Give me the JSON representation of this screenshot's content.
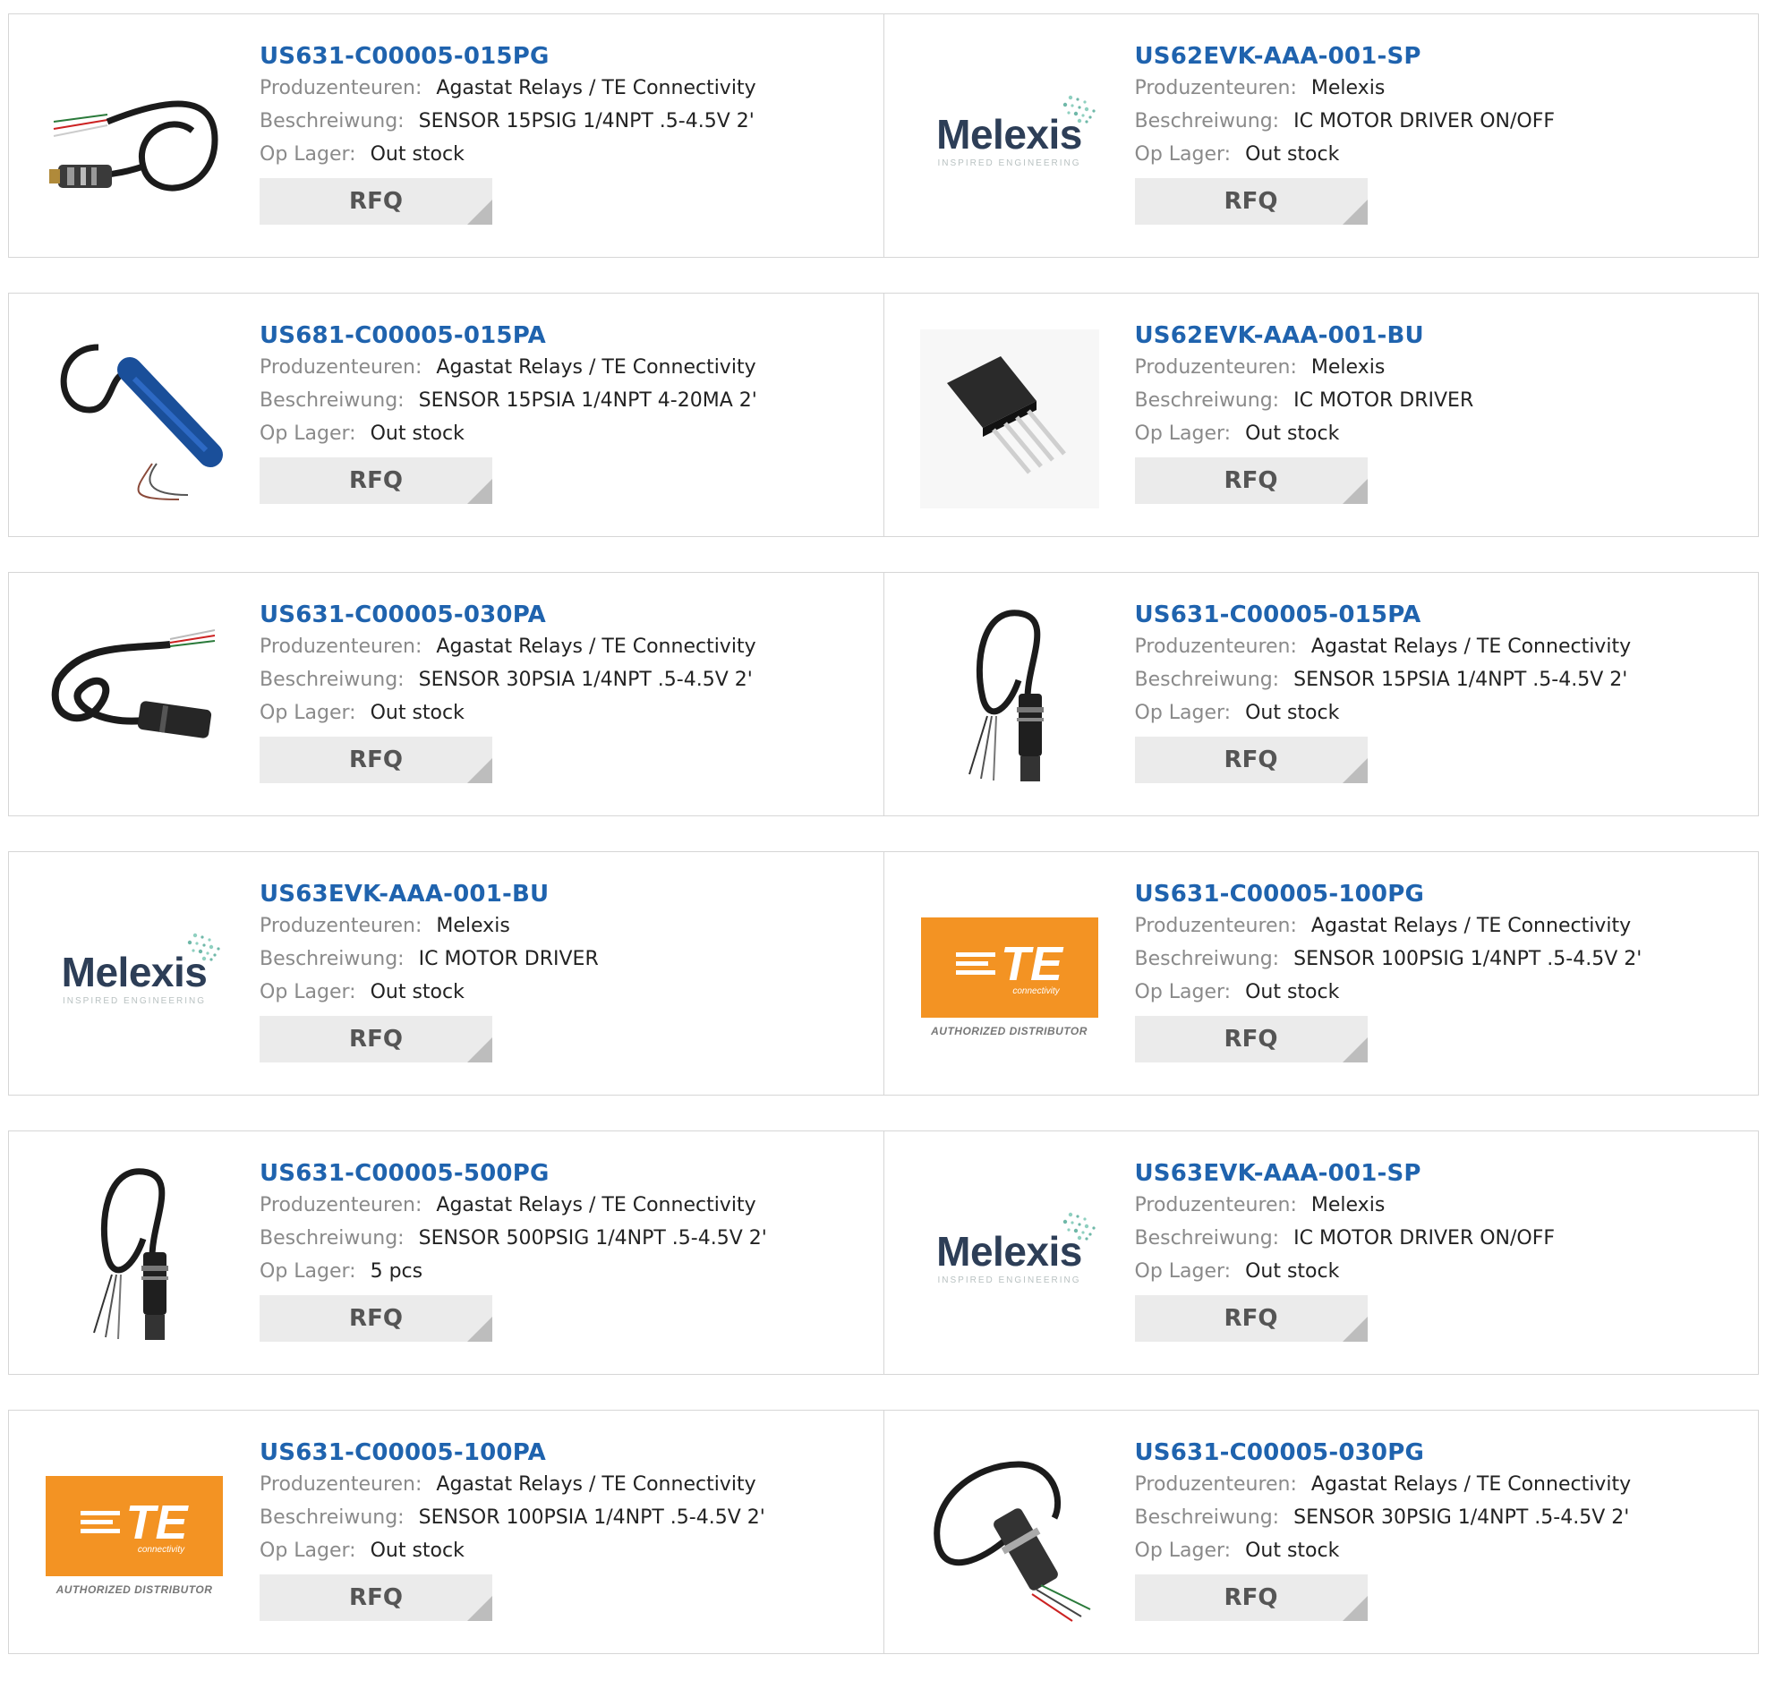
{
  "labels": {
    "manufacturer": "Produzenteuren:",
    "description": "Beschreiwung:",
    "stock": "Op Lager:",
    "rfq": "RFQ"
  },
  "colors": {
    "title_link": "#1f63ae",
    "label_gray": "#8a8a8a",
    "rfq_bg": "#ebebeb",
    "te_orange": "#f39323",
    "melexis_navy": "#2d3e57"
  },
  "logo_text": {
    "melexis_word": "Melexis",
    "melexis_tag": "INSPIRED ENGINEERING",
    "te_word": "TE",
    "te_sub": "connectivity",
    "te_authorized": "AUTHORIZED DISTRIBUTOR"
  },
  "products": [
    {
      "part": "US631-C00005-015PG",
      "manufacturer": "Agastat Relays / TE Connectivity",
      "description": "SENSOR 15PSIG 1/4NPT .5-4.5V 2'",
      "stock": "Out stock",
      "image": "sensor-cable-coil"
    },
    {
      "part": "US62EVK-AAA-001-SP",
      "manufacturer": "Melexis",
      "description": "IC MOTOR DRIVER ON/OFF",
      "stock": "Out stock",
      "image": "melexis-logo"
    },
    {
      "part": "US681-C00005-015PA",
      "manufacturer": "Agastat Relays / TE Connectivity",
      "description": "SENSOR 15PSIA 1/4NPT 4-20MA 2'",
      "stock": "Out stock",
      "image": "sensor-blue-wrapped"
    },
    {
      "part": "US62EVK-AAA-001-BU",
      "manufacturer": "Melexis",
      "description": "IC MOTOR DRIVER",
      "stock": "Out stock",
      "image": "ic-chip-4pin"
    },
    {
      "part": "US631-C00005-030PA",
      "manufacturer": "Agastat Relays / TE Connectivity",
      "description": "SENSOR 30PSIA 1/4NPT .5-4.5V 2'",
      "stock": "Out stock",
      "image": "sensor-cable-loop"
    },
    {
      "part": "US631-C00005-015PA",
      "manufacturer": "Agastat Relays / TE Connectivity",
      "description": "SENSOR 15PSIA 1/4NPT .5-4.5V 2'",
      "stock": "Out stock",
      "image": "sensor-vertical"
    },
    {
      "part": "US63EVK-AAA-001-BU",
      "manufacturer": "Melexis",
      "description": "IC MOTOR DRIVER",
      "stock": "Out stock",
      "image": "melexis-logo"
    },
    {
      "part": "US631-C00005-100PG",
      "manufacturer": "Agastat Relays / TE Connectivity",
      "description": "SENSOR 100PSIG 1/4NPT .5-4.5V 2'",
      "stock": "Out stock",
      "image": "te-logo"
    },
    {
      "part": "US631-C00005-500PG",
      "manufacturer": "Agastat Relays / TE Connectivity",
      "description": "SENSOR 500PSIG 1/4NPT .5-4.5V 2'",
      "stock": "5 pcs",
      "image": "sensor-vertical"
    },
    {
      "part": "US63EVK-AAA-001-SP",
      "manufacturer": "Melexis",
      "description": "IC MOTOR DRIVER ON/OFF",
      "stock": "Out stock",
      "image": "melexis-logo"
    },
    {
      "part": "US631-C00005-100PA",
      "manufacturer": "Agastat Relays / TE Connectivity",
      "description": "SENSOR 100PSIA 1/4NPT .5-4.5V 2'",
      "stock": "Out stock",
      "image": "te-logo"
    },
    {
      "part": "US631-C00005-030PG",
      "manufacturer": "Agastat Relays / TE Connectivity",
      "description": "SENSOR 30PSIG 1/4NPT .5-4.5V 2'",
      "stock": "Out stock",
      "image": "sensor-cable-diagonal"
    }
  ]
}
